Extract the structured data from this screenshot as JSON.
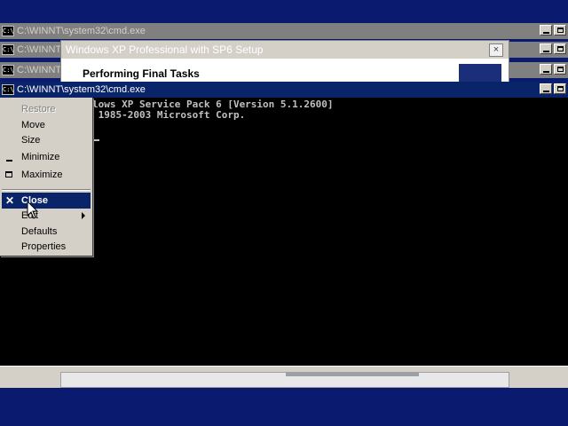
{
  "background_windows": [
    {
      "title": "C:\\WINNT\\system32\\cmd.exe"
    },
    {
      "title": "C:\\WINNT\\system32\\cmd.exe"
    },
    {
      "title": "C:\\WINNT"
    }
  ],
  "cmd_icon_text": "C:\\",
  "setup_window": {
    "title": "Windows XP Professional with SP6 Setup",
    "close_label": "×",
    "heading": "Performing Final Tasks"
  },
  "active_window": {
    "title": "C:\\WINNT\\system32\\cmd.exe",
    "console_lines": [
      "lows XP Service Pack 6 [Version 5.1.2600]",
      " 1985-2003 Microsoft Corp."
    ]
  },
  "system_menu": {
    "items": [
      {
        "label": "Restore",
        "enabled": false
      },
      {
        "label": "Move",
        "enabled": true
      },
      {
        "label": "Size",
        "enabled": true
      },
      {
        "label": "Minimize",
        "enabled": true
      },
      {
        "label": "Maximize",
        "enabled": true
      },
      {
        "label": "Close",
        "enabled": true,
        "selected": true
      },
      {
        "label": "Edit",
        "enabled": true,
        "submenu": true
      },
      {
        "label": "Defaults",
        "enabled": true
      },
      {
        "label": "Properties",
        "enabled": true
      }
    ]
  },
  "colors": {
    "desktop": "#0a1a6e",
    "active_title": "#0a246a",
    "selection": "#0a246a",
    "console_bg": "#000000",
    "console_text": "#c0c0c0"
  },
  "icons": [
    "cmd-icon",
    "minimize-icon",
    "maximize-icon",
    "close-icon",
    "submenu-arrow-icon",
    "mouse-pointer-icon"
  ]
}
